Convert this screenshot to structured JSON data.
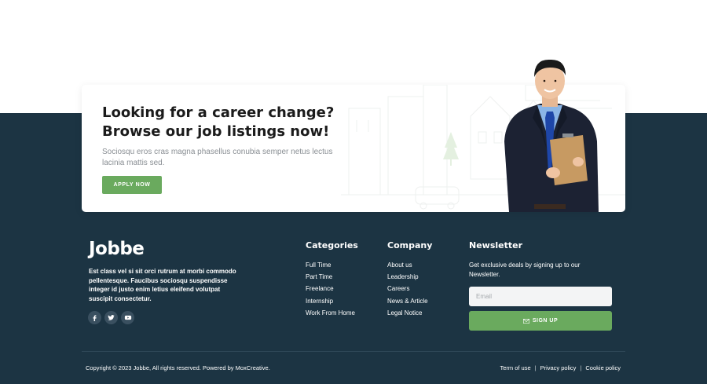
{
  "cta": {
    "title": "Looking for a career change? Browse our job listings now!",
    "description": "Sociosqu eros cras magna phasellus conubia semper netus lectus lacinia mattis sed.",
    "button_label": "APPLY NOW"
  },
  "brand": {
    "logo_text": "Jobbe",
    "about": "Est class vel si sit orci rutrum at morbi commodo pellentesque. Faucibus sociosqu suspendisse integer id justo enim letius eleifend volutpat suscipit consectetur."
  },
  "socials": [
    {
      "icon": "facebook-icon"
    },
    {
      "icon": "twitter-icon"
    },
    {
      "icon": "youtube-icon"
    }
  ],
  "categories": {
    "title": "Categories",
    "items": [
      "Full Time",
      "Part Time",
      "Freelance",
      "Internship",
      "Work From Home"
    ]
  },
  "company": {
    "title": "Company",
    "items": [
      "About us",
      "Leadership",
      "Careers",
      "News & Article",
      "Legal Notice"
    ]
  },
  "newsletter": {
    "title": "Newsletter",
    "description": "Get exclusive deals by signing up to our Newsletter.",
    "email_placeholder": "Email",
    "button_label": "SIGN UP"
  },
  "bottom": {
    "copyright": "Copyright © 2023 Jobbe, All rights reserved. Powered by MoxCreative.",
    "links": [
      "Term of use",
      "Privacy policy",
      "Cookie policy"
    ]
  },
  "colors": {
    "footer_bg": "#1c3443",
    "accent_green": "#6aaa5e",
    "heading": "#1b1b1b",
    "muted_text": "#8a8f94"
  }
}
